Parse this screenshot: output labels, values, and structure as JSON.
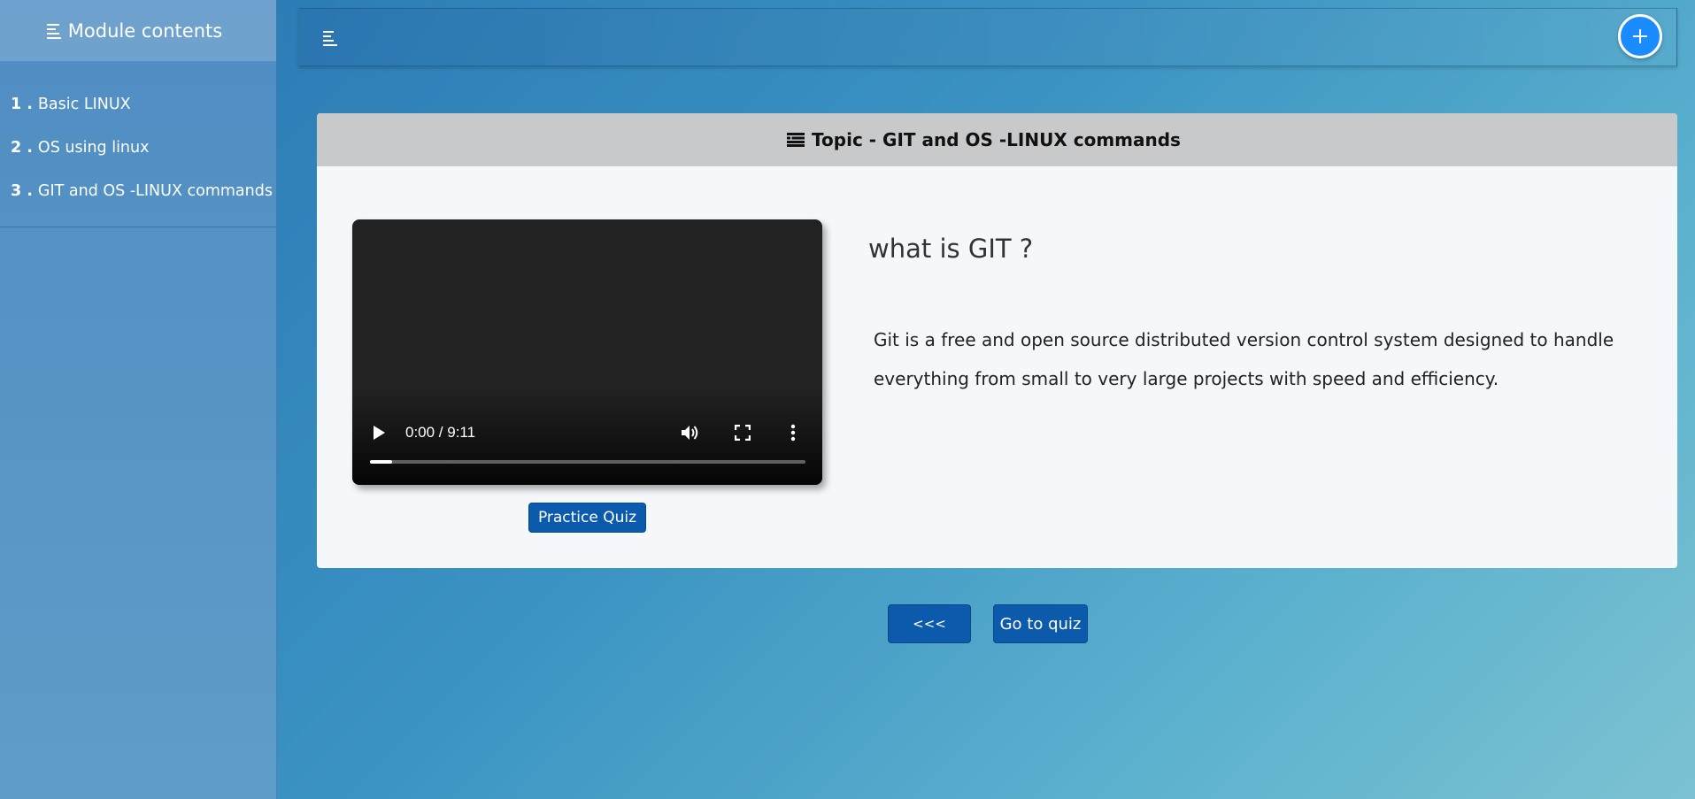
{
  "sidebar": {
    "header_label": "Module contents",
    "header_icon": "text-align-left-icon",
    "items": [
      {
        "num": "1 .",
        "label": "Basic LINUX"
      },
      {
        "num": "2 .",
        "label": "OS using linux"
      },
      {
        "num": "3 .",
        "label": "GIT and OS -LINUX commands"
      }
    ]
  },
  "topbar": {
    "menu_icon": "text-align-left-icon",
    "fab_icon": "plus-icon",
    "fab_color": "#1a8cff"
  },
  "topic": {
    "header_label": "Topic - GIT and OS -LINUX commands",
    "header_icon": "list-icon"
  },
  "video": {
    "time_label": "0:00 / 9:11",
    "progress_fraction": 0.05
  },
  "lesson": {
    "title": "what is GIT ?",
    "text": "Git is a free and open source distributed version control system designed to handle everything from small to very large projects with speed and efficiency."
  },
  "buttons": {
    "practice_quiz": "Practice Quiz",
    "prev": "<<<",
    "go_to_quiz": "Go to quiz"
  },
  "colors": {
    "button_blue": "#0b5aab",
    "card_header_bg": "#c8c9cb"
  }
}
